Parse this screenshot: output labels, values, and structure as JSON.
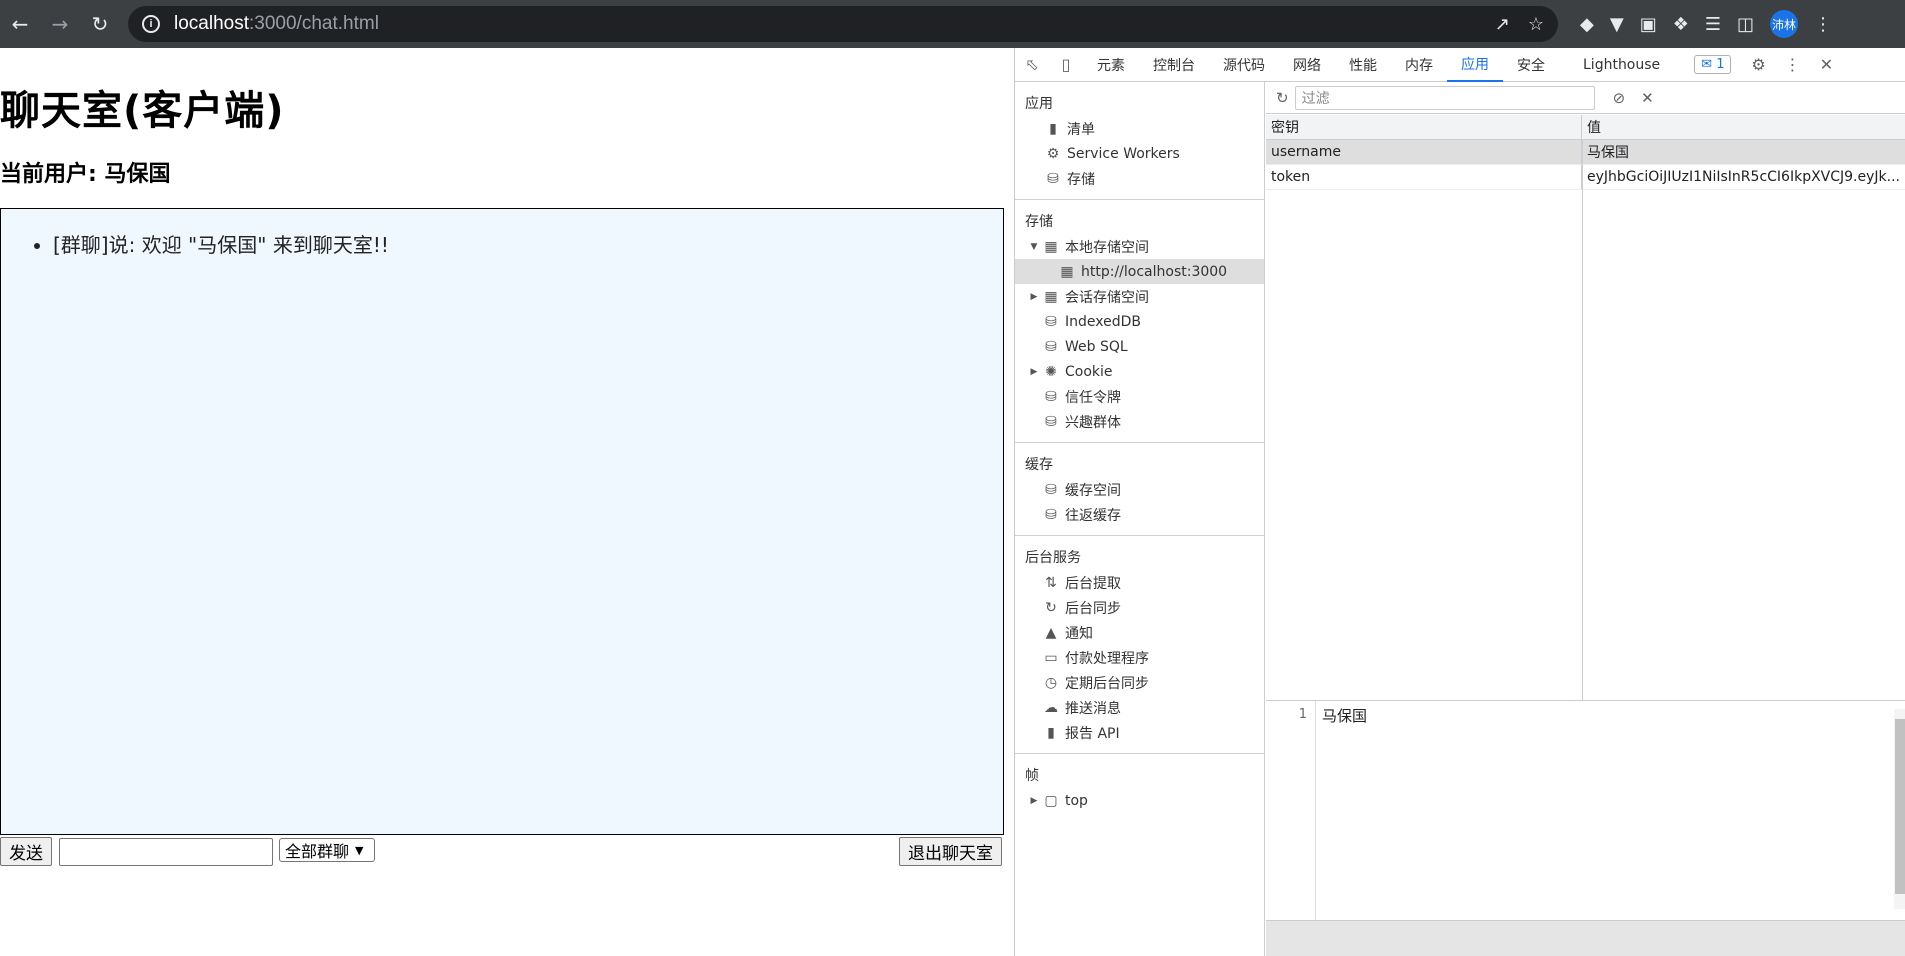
{
  "browser": {
    "url_host": "localhost",
    "url_path": ":3000/chat.html",
    "avatar_label": "沛林"
  },
  "page": {
    "title": "聊天室(客户端)",
    "current_user": "当前用户: 马保国",
    "messages": [
      "[群聊]说: 欢迎 \"马保国\" 来到聊天室!!"
    ],
    "send_label": "发送",
    "input_value": "",
    "select_value": "全部群聊",
    "exit_label": "退出聊天室"
  },
  "devtools": {
    "tabs": [
      "元素",
      "控制台",
      "源代码",
      "网络",
      "性能",
      "内存",
      "应用",
      "安全",
      "Lighthouse"
    ],
    "active_tab": "应用",
    "issues_count": "1",
    "sidebar": {
      "app_title": "应用",
      "app_items": [
        "清单",
        "Service Workers",
        "存储"
      ],
      "storage_title": "存储",
      "local_storage": "本地存储空间",
      "local_origin": "http://localhost:3000",
      "session_storage": "会话存储空间",
      "storage_items": [
        "IndexedDB",
        "Web SQL"
      ],
      "cookie": "Cookie",
      "storage_items2": [
        "信任令牌",
        "兴趣群体"
      ],
      "cache_title": "缓存",
      "cache_items": [
        "缓存空间",
        "往返缓存"
      ],
      "bg_title": "后台服务",
      "bg_items": [
        "后台提取",
        "后台同步",
        "通知",
        "付款处理程序",
        "定期后台同步",
        "推送消息",
        "报告 API"
      ],
      "frames_title": "帧",
      "frame_top": "top"
    },
    "filter_placeholder": "过滤",
    "table": {
      "key_header": "密钥",
      "value_header": "值",
      "rows": [
        {
          "key": "username",
          "value": "马保国"
        },
        {
          "key": "token",
          "value": "eyJhbGciOiJIUzI1NiIsInR5cCI6IkpXVCJ9.eyJk..."
        }
      ]
    },
    "preview": {
      "line_number": "1",
      "text": "马保国"
    }
  }
}
